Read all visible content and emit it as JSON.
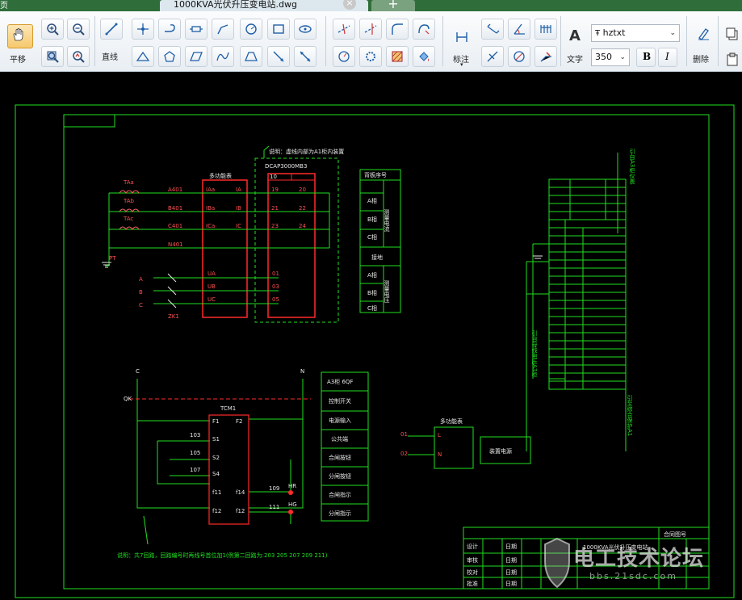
{
  "window": {
    "left_title": "页",
    "tab_title": "1000KVA光伏升压变电站.dwg",
    "close_glyph": "×",
    "new_tab_glyph": "+"
  },
  "toolbar": {
    "pan_label": "平移",
    "line_label": "直线",
    "dim_label": "标注",
    "text_label": "文字",
    "delete_label": "删除",
    "font_value": "hztxt",
    "font_icon": "Ŧ",
    "size_value": "350",
    "bold_label": "B",
    "italic_label": "I",
    "text_glyph": "A"
  },
  "drawing": {
    "note_top": "说明：虚线内部为A1柜内装置",
    "dcap_title": "DCAP3000MB3",
    "multimeter_title": "多功能表",
    "multimeter_title2": "多功能表",
    "backplate_title": "背板序号",
    "meas": {
      "a": "A相",
      "b": "B相",
      "c": "C相",
      "ground": "接地",
      "col1": "测量电流",
      "col2": "测量电压"
    },
    "phase_labels": [
      "A",
      "B",
      "C"
    ],
    "switch_label": "ZK1",
    "pt_label": "PT",
    "ct_labels": [
      "TAa",
      "TAb",
      "TAc"
    ],
    "wire_labels": [
      "A401",
      "B401",
      "C401",
      "N401"
    ],
    "dev_terminals_left": [
      "IAa",
      "IBa",
      "ICa"
    ],
    "dev_terminals_right": [
      "IA",
      "IB",
      "IC"
    ],
    "volt_terminals": [
      "UA",
      "UB",
      "UC"
    ],
    "dcap_terminals": [
      "19",
      "21",
      "23",
      "20",
      "22",
      "24",
      "01",
      "03",
      "05"
    ],
    "dcap_top": "10",
    "control": {
      "c_label": "C",
      "n_label": "N",
      "switch": "QK",
      "relay": "TCM1",
      "pins_left": [
        "F1",
        "S1",
        "S2",
        "S4",
        "f11",
        "f12"
      ],
      "pins_right": [
        "F2",
        "f14",
        "f12"
      ],
      "wires": [
        "103",
        "105",
        "107",
        "109",
        "111"
      ],
      "lamps": [
        "HR",
        "HG"
      ]
    },
    "legend_boxes": [
      "A3柜 6QF",
      "控制开关",
      "电源输入",
      "公共端",
      "合闸按钮",
      "分闸按钮",
      "合闸指示",
      "分闸指示"
    ],
    "device_power": "装置电源",
    "mm_pins": [
      "01",
      "02"
    ],
    "mm_io": [
      "L",
      "N"
    ],
    "note_bottom": "说明：共7回路，回路编号时再线号首位加1(例第二回路为:203 205 207 209 211)",
    "right_labels": [
      "引自A3柜仪表",
      "引自母线电压A3柜",
      "引至综合保护A1"
    ],
    "title_block": {
      "rows": [
        "设计",
        "审核",
        "校对",
        "批准"
      ],
      "date": "日期",
      "project": "1000KVA光伏升压变电站",
      "drawing_no": "合同图号"
    }
  },
  "watermark": {
    "brand": "电工技术论坛",
    "url": "bbs.21sdc.com"
  }
}
